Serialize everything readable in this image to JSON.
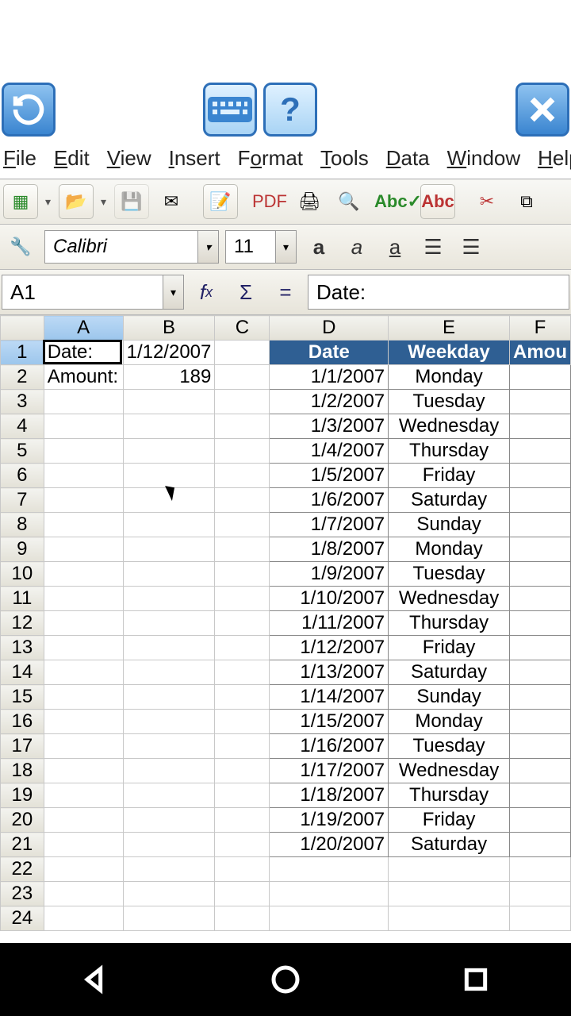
{
  "menus": {
    "file": "File",
    "edit": "Edit",
    "view": "View",
    "insert": "Insert",
    "format": "Format",
    "tools": "Tools",
    "data": "Data",
    "window": "Window",
    "help": "Help"
  },
  "font": {
    "name": "Calibri",
    "size": "11"
  },
  "cellref": "A1",
  "formula": "Date:",
  "columns": [
    "A",
    "B",
    "C",
    "D",
    "E",
    "F"
  ],
  "rowcount": 24,
  "cells": {
    "A1": "Date:",
    "B1": "1/12/2007",
    "A2": "Amount:",
    "B2": "189"
  },
  "table": {
    "headers": [
      "Date",
      "Weekday",
      "Amou"
    ],
    "rows": [
      [
        "1/1/2007",
        "Monday"
      ],
      [
        "1/2/2007",
        "Tuesday"
      ],
      [
        "1/3/2007",
        "Wednesday"
      ],
      [
        "1/4/2007",
        "Thursday"
      ],
      [
        "1/5/2007",
        "Friday"
      ],
      [
        "1/6/2007",
        "Saturday"
      ],
      [
        "1/7/2007",
        "Sunday"
      ],
      [
        "1/8/2007",
        "Monday"
      ],
      [
        "1/9/2007",
        "Tuesday"
      ],
      [
        "1/10/2007",
        "Wednesday"
      ],
      [
        "1/11/2007",
        "Thursday"
      ],
      [
        "1/12/2007",
        "Friday"
      ],
      [
        "1/13/2007",
        "Saturday"
      ],
      [
        "1/14/2007",
        "Sunday"
      ],
      [
        "1/15/2007",
        "Monday"
      ],
      [
        "1/16/2007",
        "Tuesday"
      ],
      [
        "1/17/2007",
        "Wednesday"
      ],
      [
        "1/18/2007",
        "Thursday"
      ],
      [
        "1/19/2007",
        "Friday"
      ],
      [
        "1/20/2007",
        "Saturday"
      ]
    ]
  }
}
